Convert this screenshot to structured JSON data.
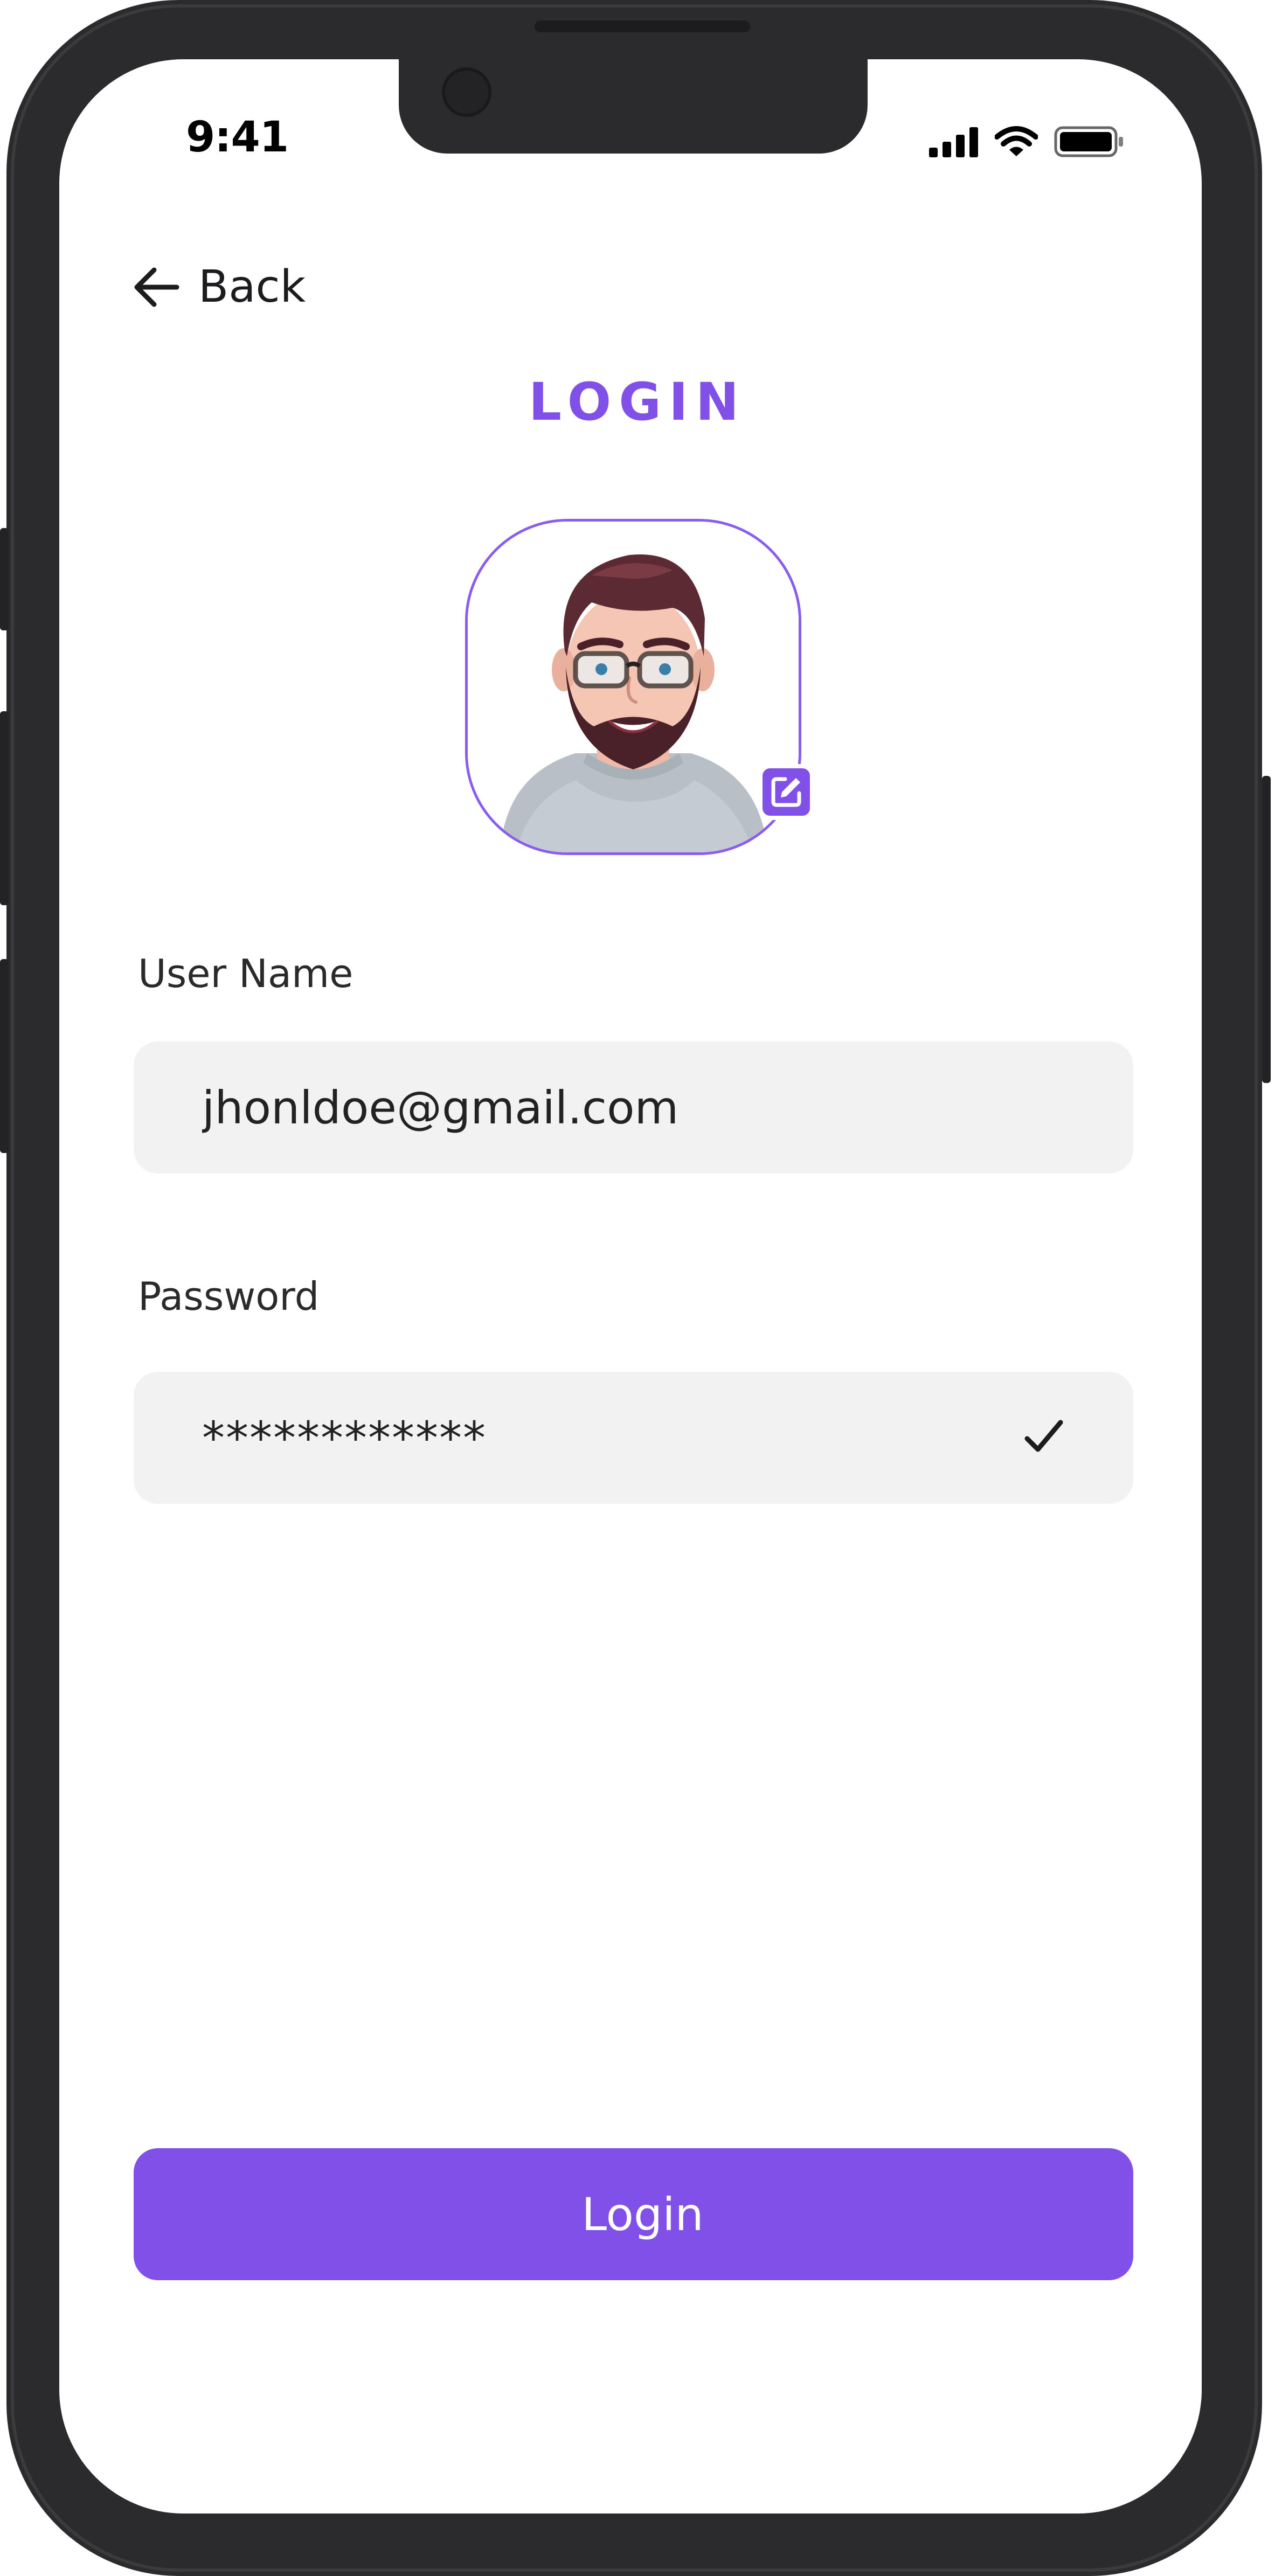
{
  "status_bar": {
    "time": "9:41",
    "icons": [
      "signal-icon",
      "wifi-icon",
      "battery-icon"
    ]
  },
  "nav": {
    "back_label": "Back",
    "back_icon": "arrow-left-icon"
  },
  "page": {
    "title": "LOGIN"
  },
  "profile": {
    "edit_icon": "edit-icon"
  },
  "form": {
    "username_label": "User Name",
    "username_value": "jhonldoe@gmail.com",
    "password_label": "Password",
    "password_value": "************",
    "password_valid_icon": "check-icon"
  },
  "actions": {
    "login_label": "Login"
  },
  "colors": {
    "accent": "#8150e8",
    "field_bg": "#f2f2f2",
    "frame": "#2b2b2d"
  }
}
